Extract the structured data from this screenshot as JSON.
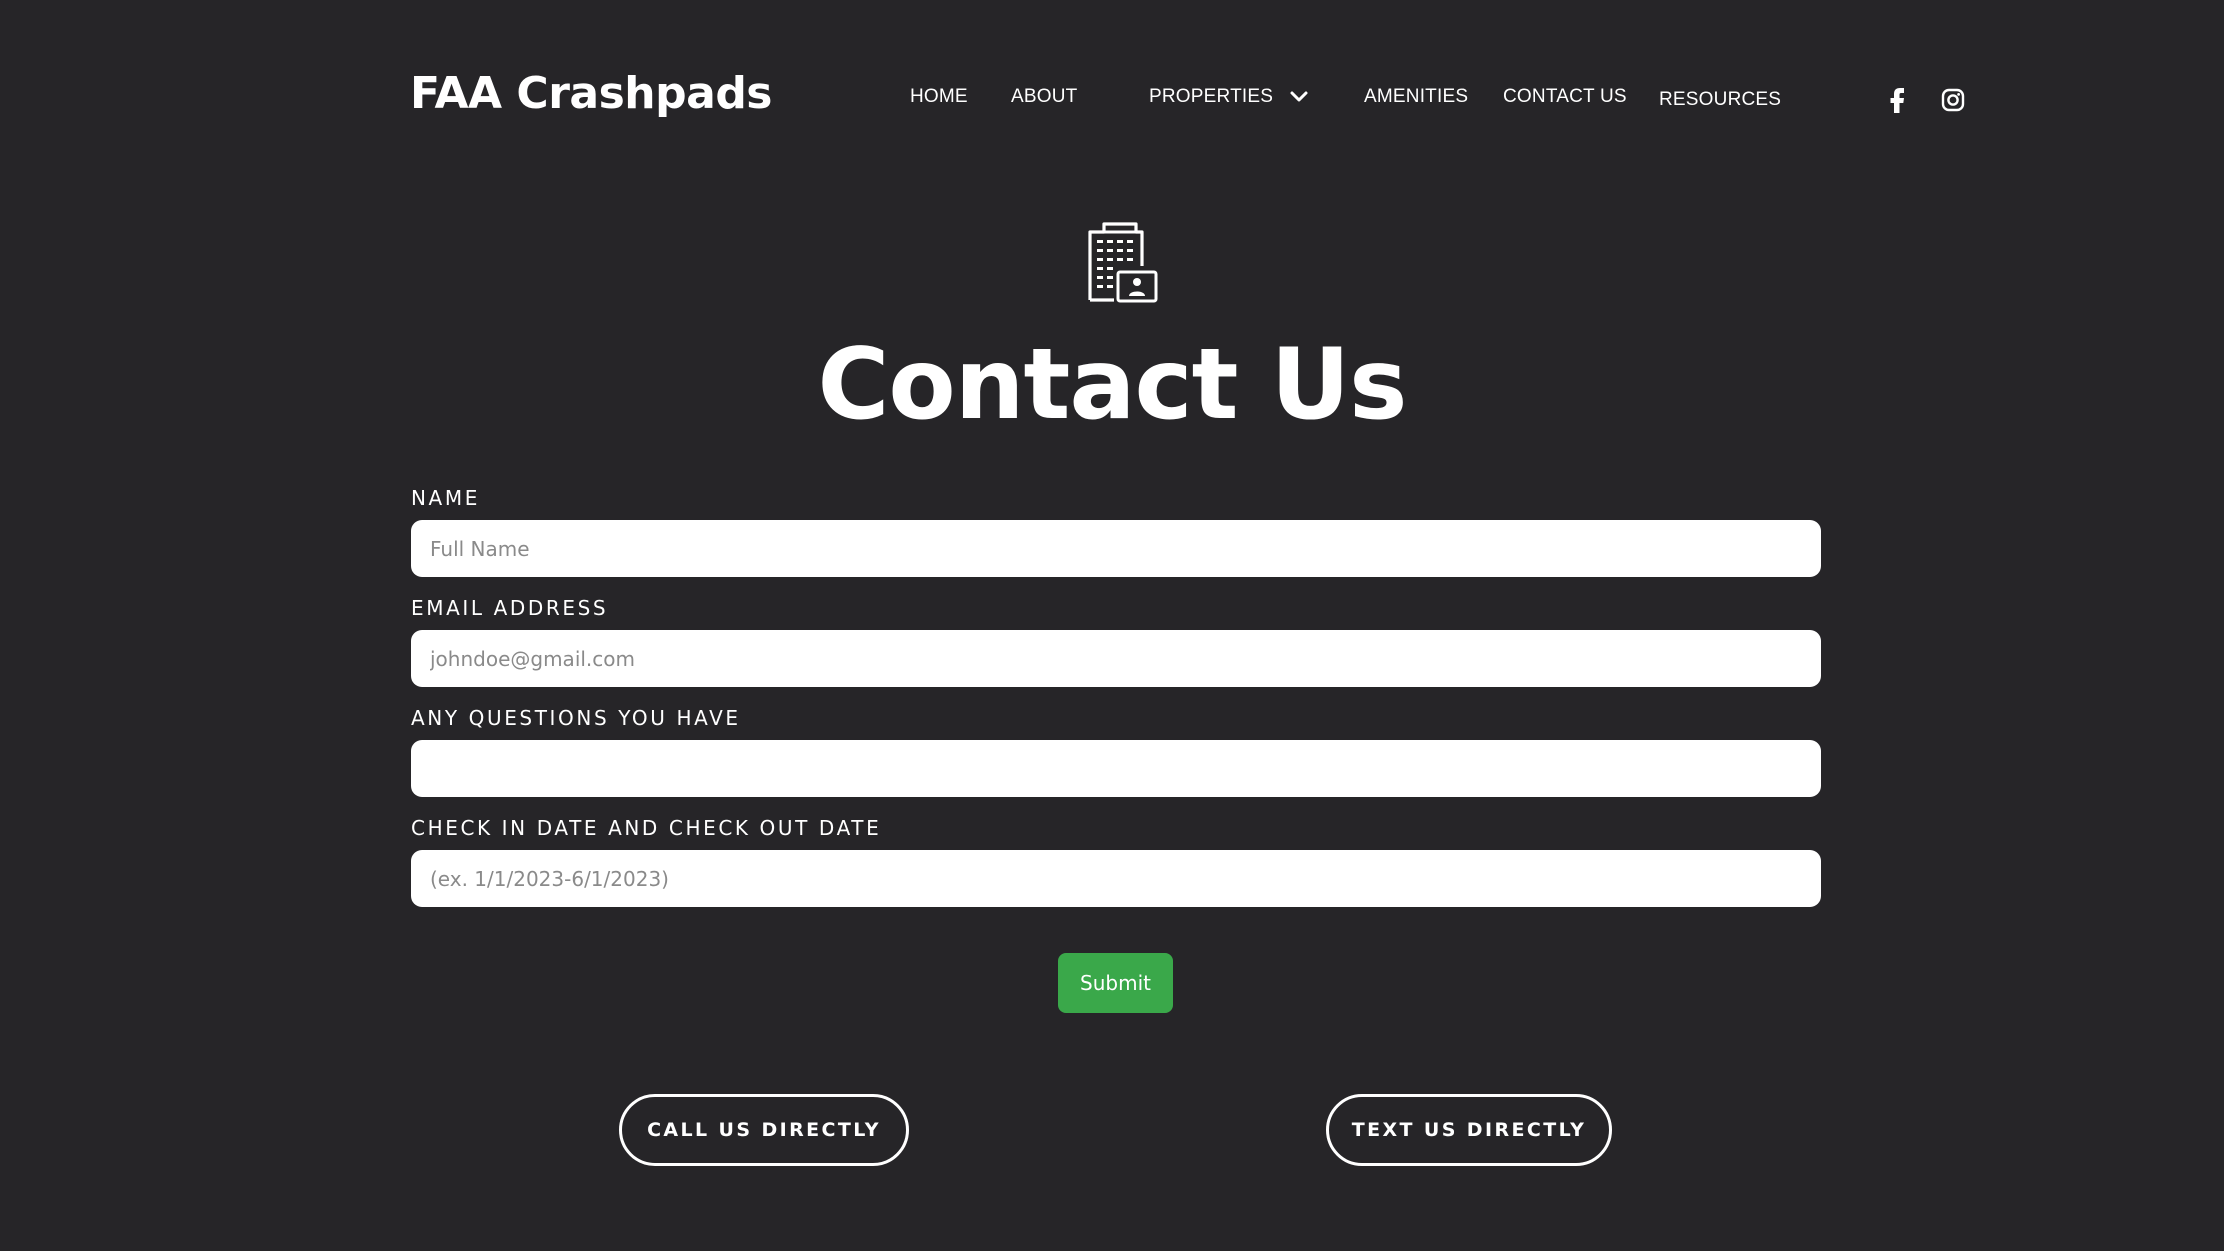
{
  "header": {
    "brand": "FAA Crashpads",
    "nav": [
      {
        "label": "HOME"
      },
      {
        "label": "ABOUT"
      },
      {
        "label": "PROPERTIES"
      },
      {
        "label": "AMENITIES"
      },
      {
        "label": "CONTACT  US"
      },
      {
        "label": "RESOURCES"
      }
    ],
    "social": [
      "facebook-icon",
      "instagram-icon"
    ]
  },
  "main": {
    "icon": "building-contact-icon",
    "title": "Contact Us"
  },
  "form": {
    "fields": [
      {
        "label": "NAME",
        "placeholder": "Full Name",
        "value": ""
      },
      {
        "label": "EMAIL ADDRESS",
        "placeholder": "johndoe@gmail.com",
        "value": ""
      },
      {
        "label": "ANY QUESTIONS YOU HAVE",
        "placeholder": "",
        "value": ""
      },
      {
        "label": "CHECK IN DATE AND CHECK OUT DATE",
        "placeholder": "(ex. 1/1/2023-6/1/2023)",
        "value": ""
      }
    ],
    "submit_label": "Submit"
  },
  "actions": {
    "call_label": "CALL US DIRECTLY",
    "text_label": "TEXT US DIRECTLY"
  },
  "colors": {
    "background": "#262528",
    "accent": "#3aa84a",
    "text": "#ffffff"
  }
}
